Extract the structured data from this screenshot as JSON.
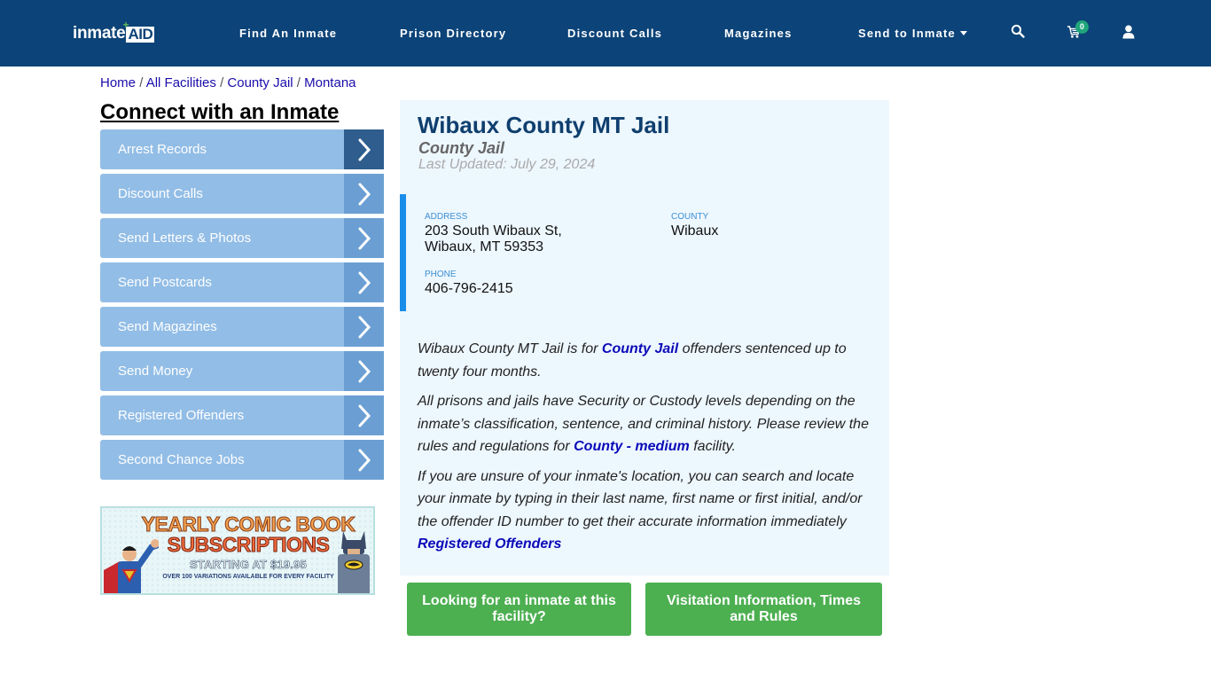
{
  "header": {
    "logo_text": "inmate",
    "logo_accent": "AID",
    "logo_plus": "+",
    "nav": [
      {
        "label": "Find An Inmate"
      },
      {
        "label": "Prison Directory"
      },
      {
        "label": "Discount Calls"
      },
      {
        "label": "Magazines"
      },
      {
        "label": "Send to Inmate"
      }
    ],
    "cart_count": "0",
    "icons": [
      "search-icon",
      "cart-icon",
      "user-icon"
    ]
  },
  "breadcrumb": [
    {
      "label": "Home"
    },
    {
      "label": "All Facilities"
    },
    {
      "label": "County Jail"
    },
    {
      "label": "Montana"
    }
  ],
  "breadcrumb_separator": "/",
  "sidebar": {
    "title": "Connect with an Inmate",
    "items": [
      {
        "label": "Arrest Records"
      },
      {
        "label": "Discount Calls"
      },
      {
        "label": "Send Letters & Photos"
      },
      {
        "label": "Send Postcards"
      },
      {
        "label": "Send Magazines"
      },
      {
        "label": "Send Money"
      },
      {
        "label": "Registered Offenders"
      },
      {
        "label": "Second Chance Jobs"
      }
    ],
    "ad": {
      "line1": "YEARLY COMIC BOOK",
      "line2": "SUBSCRIPTIONS",
      "line3": "STARTING AT $19.95",
      "line4": "OVER 100 VARIATIONS AVAILABLE FOR EVERY FACILITY"
    }
  },
  "facility": {
    "name": "Wibaux County MT Jail",
    "type": "County Jail",
    "last_updated": "Last Updated: July 29, 2024",
    "address_label": "ADDRESS",
    "address_line1": "203 South Wibaux St,",
    "address_line2": "Wibaux, MT 59353",
    "county_label": "COUNTY",
    "county": "Wibaux",
    "phone_label": "PHONE",
    "phone": "406-796-2415"
  },
  "description": {
    "p1_a": "Wibaux County MT Jail is for ",
    "p1_link": "County Jail",
    "p1_b": " offenders sentenced up to twenty four months.",
    "p2_a": "All prisons and jails have Security or Custody levels depending on the inmate’s classification, sentence, and criminal history. Please review the rules and regulations for ",
    "p2_link": "County - medium",
    "p2_b": " facility.",
    "p3": "If you are unsure of your inmate's location, you can search and locate your inmate by typing in their last name, first name or first initial, and/or the offender ID number to get their accurate information immediately",
    "p3_link": "Registered Offenders"
  },
  "buttons": {
    "find_inmate": "Looking for an inmate at this facility?",
    "visitation": "Visitation Information, Times and Rules"
  },
  "colors": {
    "header_bg": "#0c4378",
    "sidebar_item": "#92bde6",
    "sidebar_arrow": "#6b9fd3",
    "sidebar_arrow_active": "#2e5d8e",
    "panel_bg": "#edf7fe",
    "accent_bar": "#1a8de8",
    "green_button": "#4caf50",
    "link": "#0a0ab8"
  }
}
